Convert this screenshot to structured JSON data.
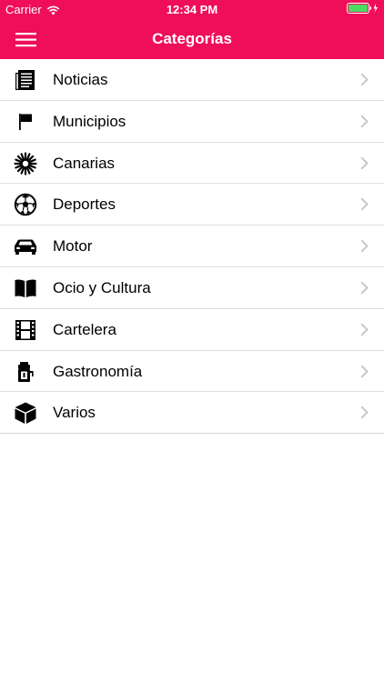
{
  "status_bar": {
    "carrier": "Carrier",
    "time": "12:34 PM",
    "battery_color": "#4cd964"
  },
  "nav": {
    "title": "Categorías",
    "menu_icon": "hamburger-menu-icon"
  },
  "colors": {
    "brand": "#ef0e5a",
    "separator": "#dedede",
    "chevron": "#c7c7cc"
  },
  "categories": [
    {
      "label": "Noticias",
      "icon": "newspaper-icon"
    },
    {
      "label": "Municipios",
      "icon": "flag-icon"
    },
    {
      "label": "Canarias",
      "icon": "starburst-icon"
    },
    {
      "label": "Deportes",
      "icon": "soccer-ball-icon"
    },
    {
      "label": "Motor",
      "icon": "car-icon"
    },
    {
      "label": "Ocio y Cultura",
      "icon": "open-book-icon"
    },
    {
      "label": "Cartelera",
      "icon": "film-strip-icon"
    },
    {
      "label": "Gastronomía",
      "icon": "kitchen-appliance-icon"
    },
    {
      "label": "Varios",
      "icon": "box-icon"
    }
  ]
}
